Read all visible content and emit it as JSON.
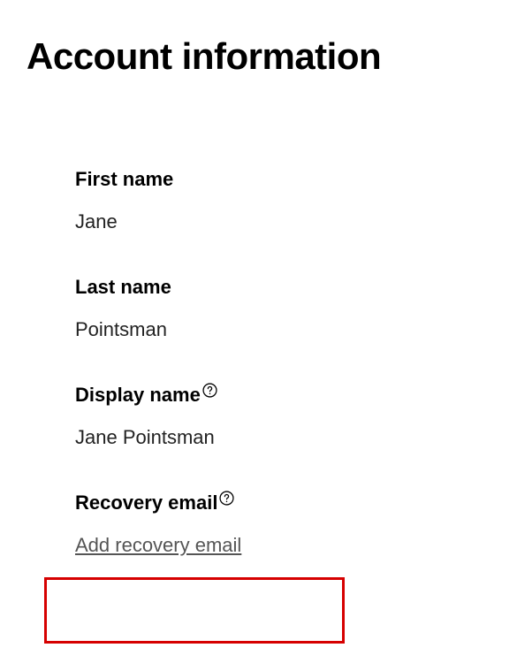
{
  "page": {
    "title": "Account information"
  },
  "fields": {
    "first_name": {
      "label": "First name",
      "value": "Jane"
    },
    "last_name": {
      "label": "Last name",
      "value": "Pointsman"
    },
    "display_name": {
      "label": "Display name",
      "value": "Jane Pointsman"
    },
    "recovery_email": {
      "label": "Recovery email",
      "action": "Add recovery email"
    }
  }
}
